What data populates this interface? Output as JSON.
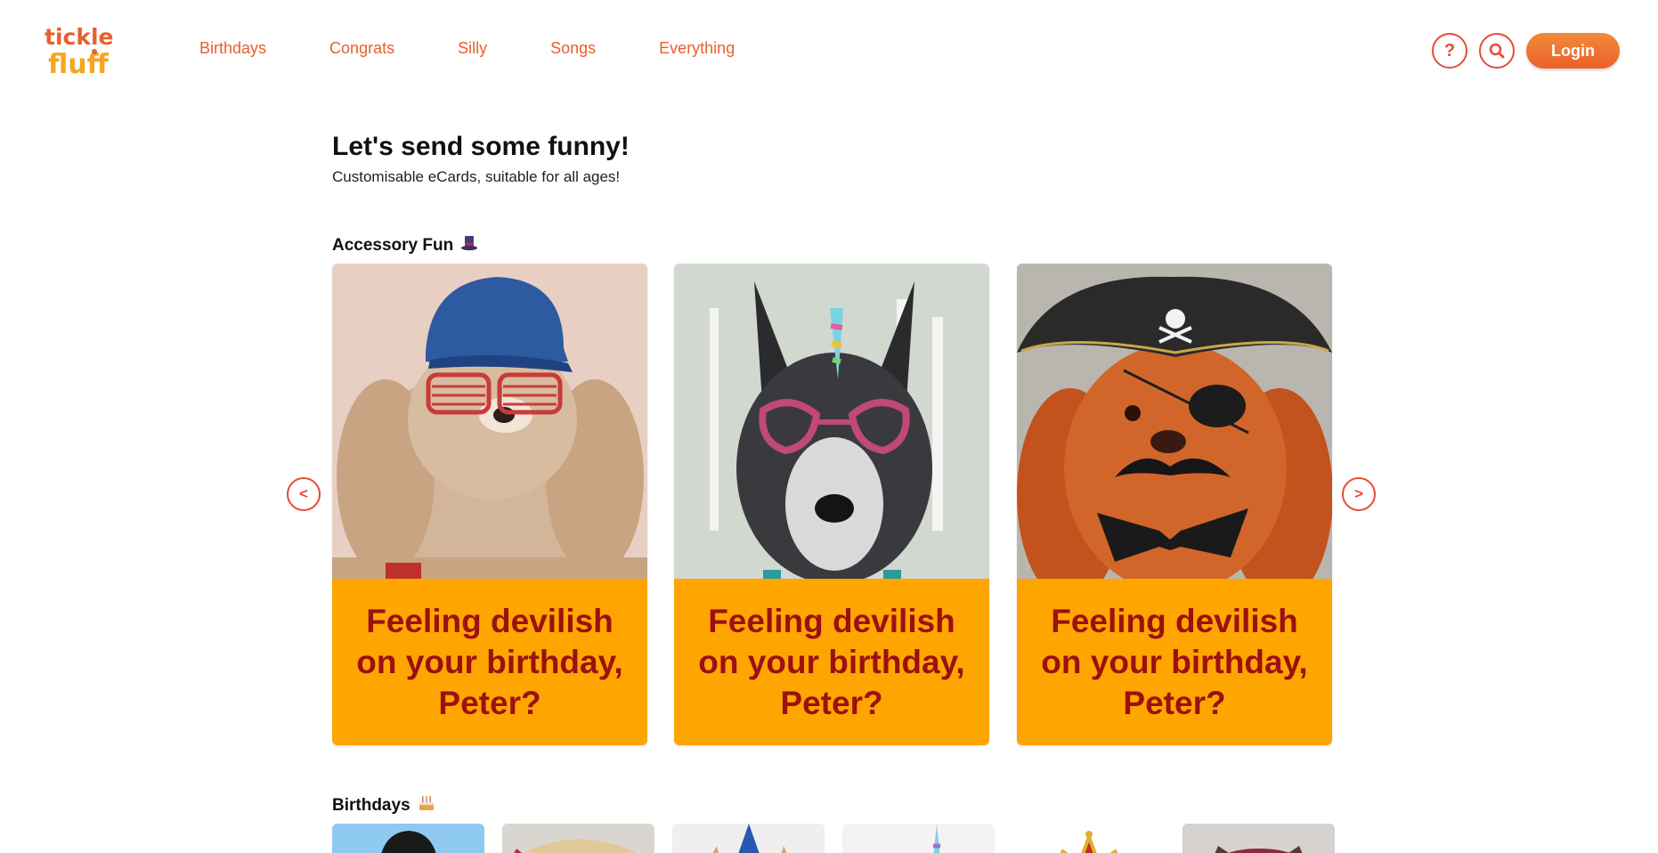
{
  "brand": {
    "line1": "tickle",
    "line2": "fluff",
    "accent": "#e8602c",
    "accent_secondary": "#f5a623"
  },
  "nav": {
    "items": [
      {
        "label": "Birthdays"
      },
      {
        "label": "Congrats"
      },
      {
        "label": "Silly"
      },
      {
        "label": "Songs"
      },
      {
        "label": "Everything"
      }
    ]
  },
  "header": {
    "help_label": "?",
    "login_label": "Login",
    "help_icon": "question-icon",
    "search_icon": "search-icon"
  },
  "intro": {
    "title": "Let's send some funny!",
    "subtitle": "Customisable eCards, suitable for all ages!"
  },
  "sections": {
    "accessory": {
      "title": "Accessory Fun",
      "icon": "top-hat-icon"
    },
    "birthdays": {
      "title": "Birthdays",
      "icon": "birthday-cake-icon"
    }
  },
  "carousel": {
    "prev_label": "<",
    "next_label": ">",
    "caption_color": "#9b1010",
    "caption_background": "#ffa500",
    "cards": [
      {
        "caption": "Feeling devilish on your birthday, Peter?",
        "image": "dog-with-cap-and-shutter-shades"
      },
      {
        "caption": "Feeling devilish on your birthday, Peter?",
        "image": "dog-with-unicorn-horn-and-heart-glasses"
      },
      {
        "caption": "Feeling devilish on your birthday, Peter?",
        "image": "dog-with-pirate-hat-eyepatch-mustache"
      }
    ]
  },
  "birthday_thumbs": [
    {
      "image": "bowler-hat-dog"
    },
    {
      "image": "sombrero-dog"
    },
    {
      "image": "party-hat-dog"
    },
    {
      "image": "unicorn-dog"
    },
    {
      "image": "crown-dog"
    },
    {
      "image": "beret-cat"
    }
  ]
}
